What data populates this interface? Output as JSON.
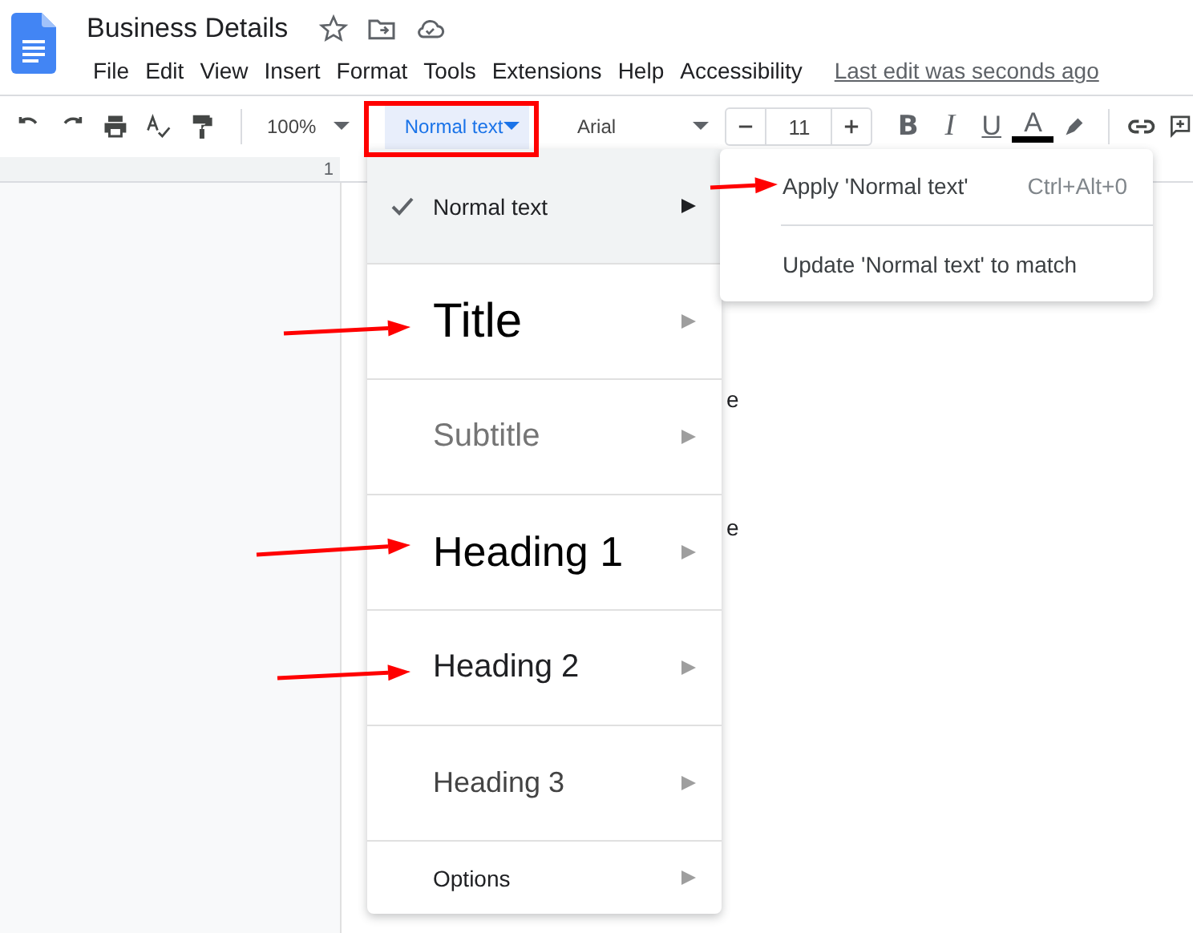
{
  "document": {
    "title": "Business Details"
  },
  "menu_bar": [
    "File",
    "Edit",
    "View",
    "Insert",
    "Format",
    "Tools",
    "Extensions",
    "Help",
    "Accessibility"
  ],
  "last_edit": "Last edit was seconds ago",
  "toolbar": {
    "zoom": "100%",
    "style": "Normal text",
    "font": "Arial",
    "font_size": "11",
    "format_buttons": [
      "B",
      "I",
      "U",
      "A"
    ]
  },
  "ruler": {
    "mark": "1"
  },
  "page_fragments": [
    "e",
    "e"
  ],
  "style_menu": [
    {
      "kind": "style",
      "label": "Normal text",
      "selected": true
    },
    {
      "kind": "style",
      "label": "Title",
      "selected": false
    },
    {
      "kind": "style",
      "label": "Subtitle",
      "selected": false
    },
    {
      "kind": "style",
      "label": "Heading 1",
      "selected": false
    },
    {
      "kind": "style",
      "label": "Heading 2",
      "selected": false
    },
    {
      "kind": "style",
      "label": "Heading 3",
      "selected": false
    },
    {
      "kind": "options",
      "label": "Options"
    }
  ],
  "submenu": [
    {
      "label": "Apply 'Normal text'",
      "shortcut": "Ctrl+Alt+0"
    },
    {
      "label": "Update 'Normal text' to match"
    }
  ]
}
